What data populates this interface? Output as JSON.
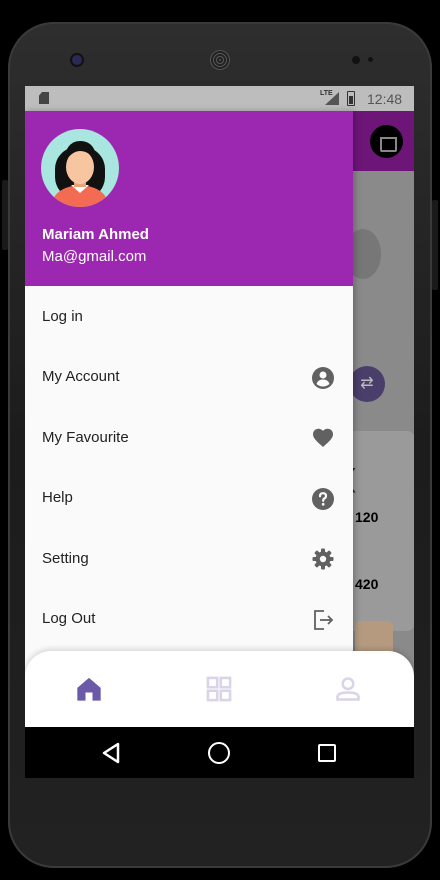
{
  "status_bar": {
    "time": "12:48",
    "network": "LTE"
  },
  "background": {
    "price_1": "120",
    "price_2": "420"
  },
  "drawer": {
    "header_color": "#9c27b0",
    "user_name": "Mariam Ahmed",
    "user_email": "Ma@gmail.com",
    "items": [
      {
        "label": "Log in",
        "icon": ""
      },
      {
        "label": "My Account",
        "icon": "account-circle-icon"
      },
      {
        "label": "My Favourite",
        "icon": "heart-icon"
      },
      {
        "label": "Help",
        "icon": "help-circle-icon"
      },
      {
        "label": "Setting",
        "icon": "gear-icon"
      },
      {
        "label": "Log Out",
        "icon": "logout-icon"
      }
    ]
  },
  "bottom_nav": {
    "active_color": "#6a5aa8",
    "inactive_color": "#d9d4e8",
    "items": [
      {
        "icon": "home-icon",
        "active": true
      },
      {
        "icon": "grid-icon",
        "active": false
      },
      {
        "icon": "person-icon",
        "active": false
      }
    ]
  }
}
